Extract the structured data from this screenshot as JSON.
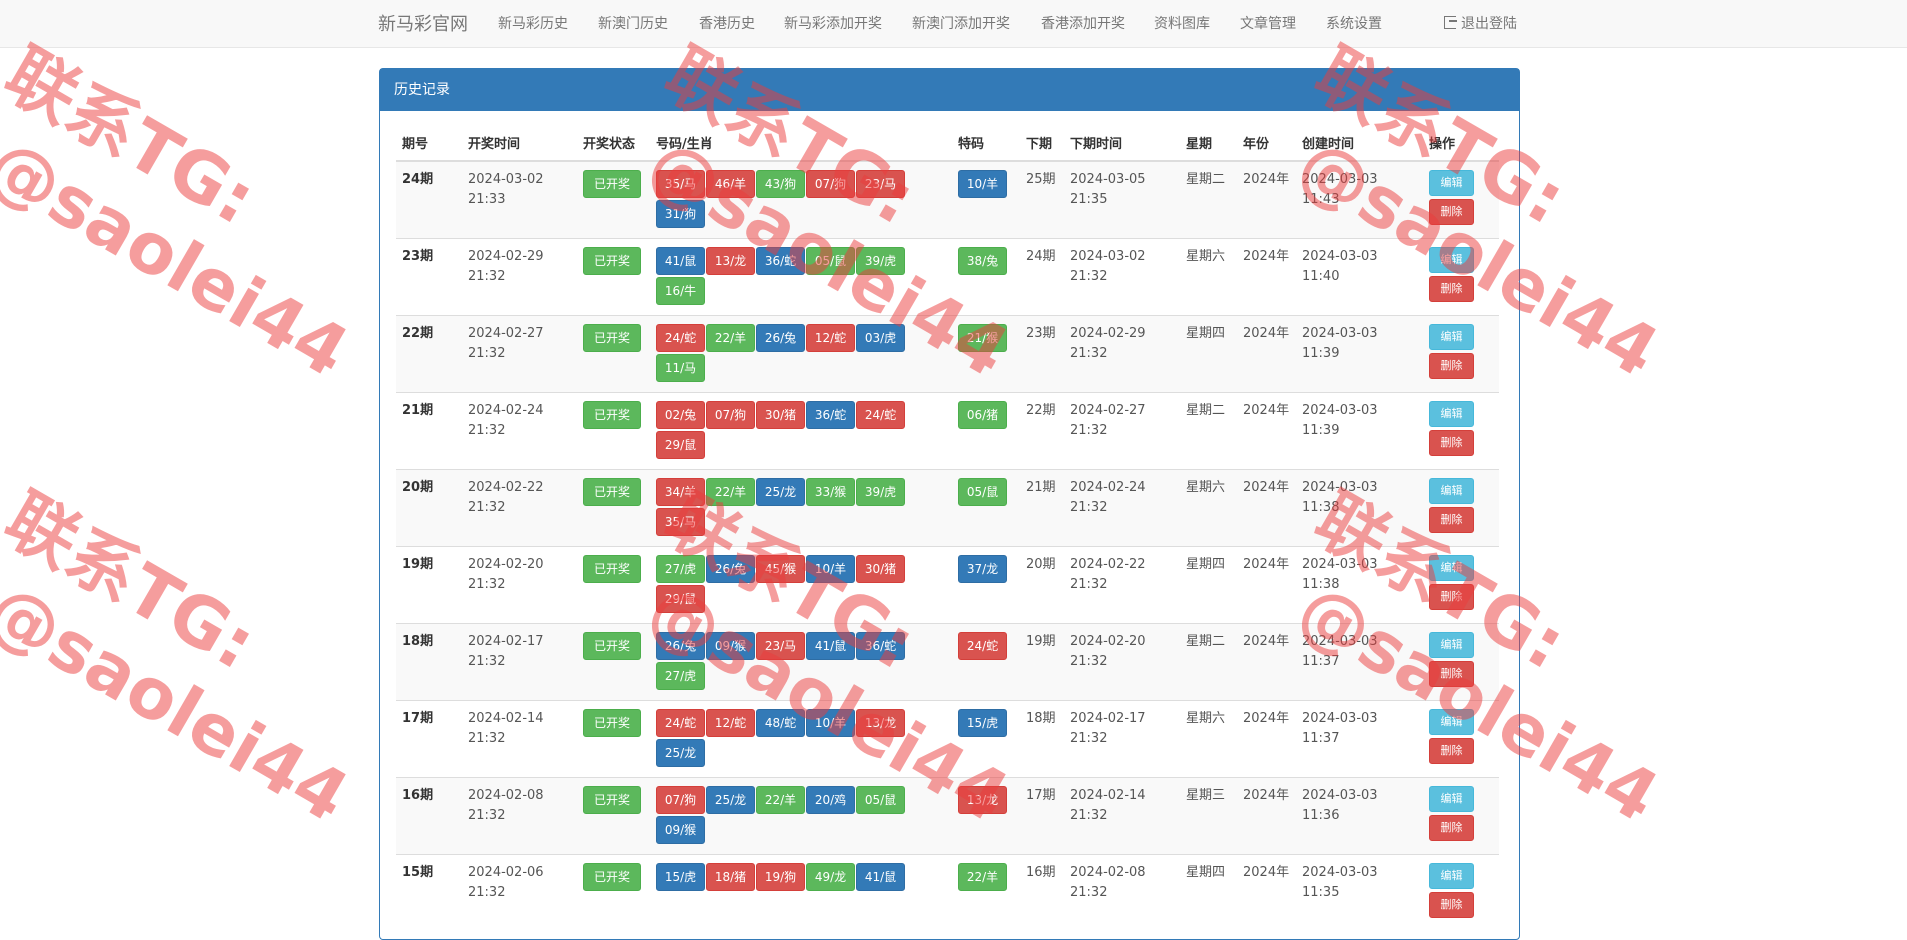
{
  "nav": {
    "brand": "新马彩官网",
    "items": [
      "新马彩历史",
      "新澳门历史",
      "香港历史",
      "新马彩添加开奖",
      "新澳门添加开奖",
      "香港添加开奖",
      "资料图库",
      "文章管理",
      "系统设置"
    ],
    "logout": "退出登陆"
  },
  "panel": {
    "title": "历史记录"
  },
  "table": {
    "headers": [
      "期号",
      "开奖时间",
      "开奖状态",
      "号码/生肖",
      "特码",
      "下期",
      "下期时间",
      "星期",
      "年份",
      "创建时间",
      "操作"
    ],
    "edit_label": "编辑",
    "delete_label": "删除",
    "rows": [
      {
        "period": "24期",
        "draw_time": "2024-03-02 21:33",
        "status": "已开奖",
        "balls": [
          [
            "35/马",
            "red"
          ],
          [
            "46/羊",
            "red"
          ],
          [
            "43/狗",
            "green"
          ],
          [
            "07/狗",
            "red"
          ],
          [
            "23/马",
            "red"
          ],
          [
            "31/狗",
            "blue"
          ]
        ],
        "special": [
          "10/羊",
          "blue"
        ],
        "next": "25期",
        "next_time": "2024-03-05 21:35",
        "weekday": "星期二",
        "year": "2024年",
        "created": "2024-03-03 11:43"
      },
      {
        "period": "23期",
        "draw_time": "2024-02-29 21:32",
        "status": "已开奖",
        "balls": [
          [
            "41/鼠",
            "blue"
          ],
          [
            "13/龙",
            "red"
          ],
          [
            "36/蛇",
            "blue"
          ],
          [
            "05/鼠",
            "green"
          ],
          [
            "39/虎",
            "green"
          ],
          [
            "16/牛",
            "green"
          ]
        ],
        "special": [
          "38/兔",
          "green"
        ],
        "next": "24期",
        "next_time": "2024-03-02 21:32",
        "weekday": "星期六",
        "year": "2024年",
        "created": "2024-03-03 11:40"
      },
      {
        "period": "22期",
        "draw_time": "2024-02-27 21:32",
        "status": "已开奖",
        "balls": [
          [
            "24/蛇",
            "red"
          ],
          [
            "22/羊",
            "green"
          ],
          [
            "26/兔",
            "blue"
          ],
          [
            "12/蛇",
            "red"
          ],
          [
            "03/虎",
            "blue"
          ],
          [
            "11/马",
            "green"
          ]
        ],
        "special": [
          "21/猴",
          "green"
        ],
        "next": "23期",
        "next_time": "2024-02-29 21:32",
        "weekday": "星期四",
        "year": "2024年",
        "created": "2024-03-03 11:39"
      },
      {
        "period": "21期",
        "draw_time": "2024-02-24 21:32",
        "status": "已开奖",
        "balls": [
          [
            "02/兔",
            "red"
          ],
          [
            "07/狗",
            "red"
          ],
          [
            "30/猪",
            "red"
          ],
          [
            "36/蛇",
            "blue"
          ],
          [
            "24/蛇",
            "red"
          ],
          [
            "29/鼠",
            "red"
          ]
        ],
        "special": [
          "06/猪",
          "green"
        ],
        "next": "22期",
        "next_time": "2024-02-27 21:32",
        "weekday": "星期二",
        "year": "2024年",
        "created": "2024-03-03 11:39"
      },
      {
        "period": "20期",
        "draw_time": "2024-02-22 21:32",
        "status": "已开奖",
        "balls": [
          [
            "34/羊",
            "red"
          ],
          [
            "22/羊",
            "green"
          ],
          [
            "25/龙",
            "blue"
          ],
          [
            "33/猴",
            "green"
          ],
          [
            "39/虎",
            "green"
          ],
          [
            "35/马",
            "red"
          ]
        ],
        "special": [
          "05/鼠",
          "green"
        ],
        "next": "21期",
        "next_time": "2024-02-24 21:32",
        "weekday": "星期六",
        "year": "2024年",
        "created": "2024-03-03 11:38"
      },
      {
        "period": "19期",
        "draw_time": "2024-02-20 21:32",
        "status": "已开奖",
        "balls": [
          [
            "27/虎",
            "green"
          ],
          [
            "26/兔",
            "blue"
          ],
          [
            "45/猴",
            "red"
          ],
          [
            "10/羊",
            "blue"
          ],
          [
            "30/猪",
            "red"
          ],
          [
            "29/鼠",
            "red"
          ]
        ],
        "special": [
          "37/龙",
          "blue"
        ],
        "next": "20期",
        "next_time": "2024-02-22 21:32",
        "weekday": "星期四",
        "year": "2024年",
        "created": "2024-03-03 11:38"
      },
      {
        "period": "18期",
        "draw_time": "2024-02-17 21:32",
        "status": "已开奖",
        "balls": [
          [
            "26/兔",
            "blue"
          ],
          [
            "09/猴",
            "blue"
          ],
          [
            "23/马",
            "red"
          ],
          [
            "41/鼠",
            "blue"
          ],
          [
            "36/蛇",
            "blue"
          ],
          [
            "27/虎",
            "green"
          ]
        ],
        "special": [
          "24/蛇",
          "red"
        ],
        "next": "19期",
        "next_time": "2024-02-20 21:32",
        "weekday": "星期二",
        "year": "2024年",
        "created": "2024-03-03 11:37"
      },
      {
        "period": "17期",
        "draw_time": "2024-02-14 21:32",
        "status": "已开奖",
        "balls": [
          [
            "24/蛇",
            "red"
          ],
          [
            "12/蛇",
            "red"
          ],
          [
            "48/蛇",
            "blue"
          ],
          [
            "10/羊",
            "blue"
          ],
          [
            "13/龙",
            "red"
          ],
          [
            "25/龙",
            "blue"
          ]
        ],
        "special": [
          "15/虎",
          "blue"
        ],
        "next": "18期",
        "next_time": "2024-02-17 21:32",
        "weekday": "星期六",
        "year": "2024年",
        "created": "2024-03-03 11:37"
      },
      {
        "period": "16期",
        "draw_time": "2024-02-08 21:32",
        "status": "已开奖",
        "balls": [
          [
            "07/狗",
            "red"
          ],
          [
            "25/龙",
            "blue"
          ],
          [
            "22/羊",
            "green"
          ],
          [
            "20/鸡",
            "blue"
          ],
          [
            "05/鼠",
            "green"
          ],
          [
            "09/猴",
            "blue"
          ]
        ],
        "special": [
          "13/龙",
          "red"
        ],
        "next": "17期",
        "next_time": "2024-02-14 21:32",
        "weekday": "星期三",
        "year": "2024年",
        "created": "2024-03-03 11:36"
      },
      {
        "period": "15期",
        "draw_time": "2024-02-06 21:32",
        "status": "已开奖",
        "balls": [
          [
            "15/虎",
            "blue"
          ],
          [
            "18/猪",
            "red"
          ],
          [
            "19/狗",
            "red"
          ],
          [
            "49/龙",
            "green"
          ],
          [
            "41/鼠",
            "blue"
          ]
        ],
        "special": [
          "22/羊",
          "green"
        ],
        "next": "16期",
        "next_time": "2024-02-08 21:32",
        "weekday": "星期四",
        "year": "2024年",
        "created": "2024-03-03 11:35"
      }
    ]
  },
  "watermark": {
    "line1": "联系TG:",
    "line2": "@saolei44"
  }
}
